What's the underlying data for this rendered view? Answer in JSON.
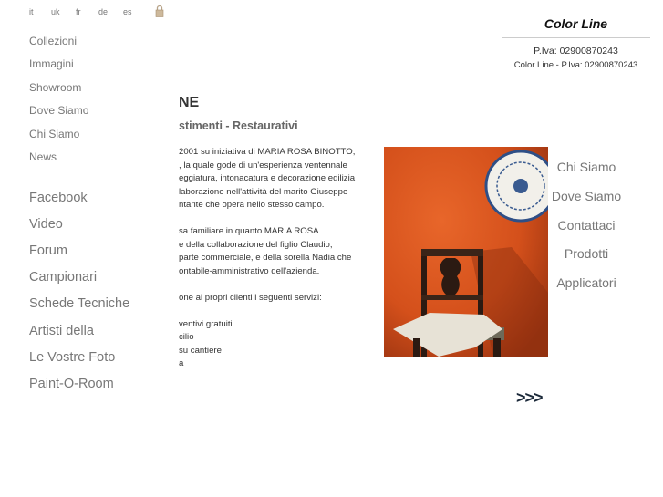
{
  "languages": [
    "it",
    "uk",
    "fr",
    "de",
    "es"
  ],
  "lock_icon": "padlock-icon",
  "menu_primary": [
    "Collezioni",
    "Immagini",
    "Showroom",
    "Dove Siamo",
    "Chi Siamo",
    "News"
  ],
  "menu_secondary": [
    "Facebook",
    "Video",
    "Forum",
    "Campionari",
    "Schede Tecniche",
    "Artisti della",
    "Le Vostre Foto",
    "Paint-O-Room"
  ],
  "main": {
    "title": "NE",
    "subtitle": "stimenti - Restaurativi",
    "lines": [
      "2001 su iniziativa di MARIA ROSA BINOTTO,",
      ", la quale gode di un'esperienza ventennale",
      "eggiatura, intonacatura e decorazione edilizia",
      "laborazione nell'attività del marito Giuseppe",
      "ntante che opera nello stesso campo.",
      "",
      "sa familiare in quanto MARIA ROSA",
      "e della collaborazione del figlio Claudio,",
      "parte commerciale, e della sorella Nadia che",
      "ontabile-amministrativo dell'azienda.",
      "",
      "one ai propri clienti i seguenti servizi:",
      "",
      "ventivi gratuiti",
      "cilio",
      "su cantiere",
      "a"
    ]
  },
  "header": {
    "brand": "Color Line",
    "piva": "P.Iva: 02900870243",
    "piva_full": "Color Line - P.Iva: 02900870243"
  },
  "right_menu": [
    "Chi Siamo",
    "Dove Siamo",
    "Contattaci",
    "Prodotti",
    "Applicatori"
  ],
  "more_label": ">>>",
  "colors": {
    "photo_wall": "#d9541c",
    "nav_text": "#777777",
    "more_arrow": "#1c2a3a"
  }
}
